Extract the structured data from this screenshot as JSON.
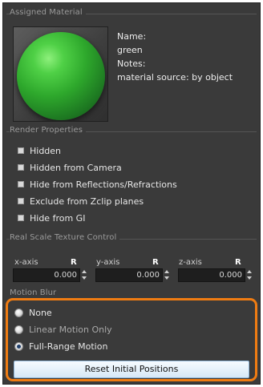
{
  "assigned_material": {
    "title": "Assigned Material",
    "name_label": "Name:",
    "name_value": "green",
    "notes_label": "Notes:",
    "notes_value": "material source: by object"
  },
  "render_properties": {
    "title": "Render Properties",
    "options": [
      {
        "label": "Hidden",
        "checked": false
      },
      {
        "label": "Hidden from Camera",
        "checked": false
      },
      {
        "label": "Hide from Reflections/Refractions",
        "checked": false
      },
      {
        "label": "Exclude from Zclip planes",
        "checked": false
      },
      {
        "label": "Hide from GI",
        "checked": false
      }
    ]
  },
  "real_scale": {
    "title": "Real Scale Texture Control",
    "axes": [
      {
        "label": "x-axis",
        "r": "R",
        "value": "0.000"
      },
      {
        "label": "y-axis",
        "r": "R",
        "value": "0.000"
      },
      {
        "label": "z-axis",
        "r": "R",
        "value": "0.000"
      }
    ]
  },
  "motion_blur": {
    "title": "Motion Blur",
    "options": [
      {
        "label": "None",
        "selected": false
      },
      {
        "label": "Linear Motion Only",
        "selected": false
      },
      {
        "label": "Full-Range Motion",
        "selected": true
      }
    ],
    "reset_label": "Reset Initial Positions"
  },
  "colors": {
    "panel_bg": "#3a3a3a",
    "highlight": "#f07c12",
    "material": "#2ea82c"
  }
}
